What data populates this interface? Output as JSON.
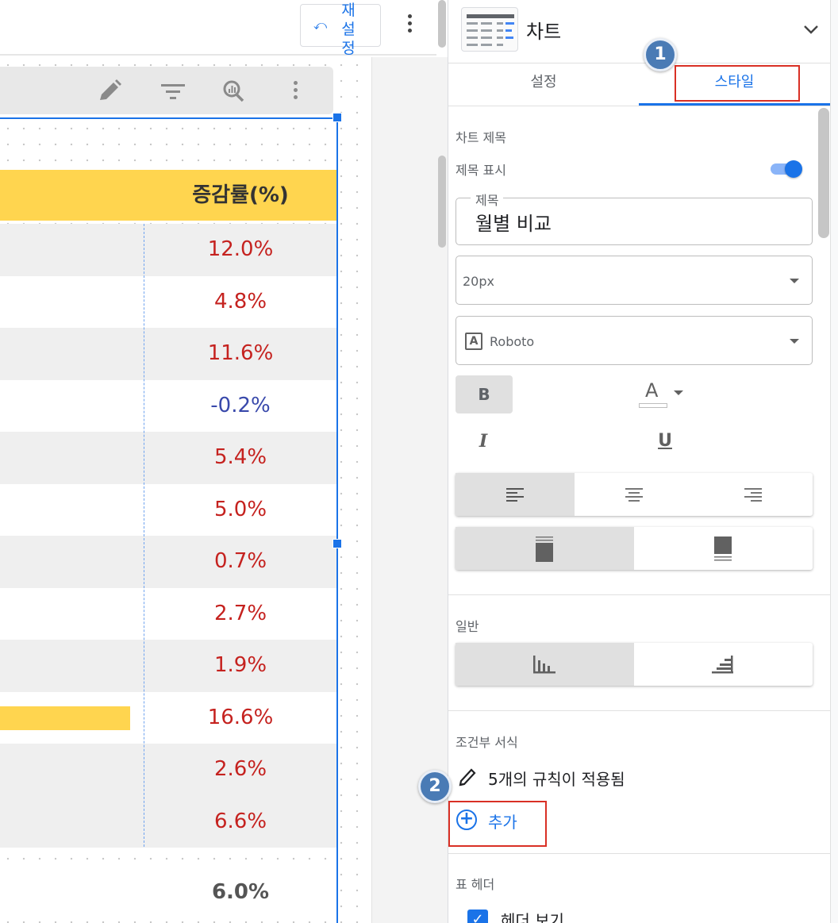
{
  "toolbar": {
    "reset_label": "재설정"
  },
  "table": {
    "header": "증감률(%)",
    "rows": [
      {
        "value": "12.0%",
        "color": "#c5221f",
        "shaded": true
      },
      {
        "value": "4.8%",
        "color": "#c5221f",
        "shaded": false
      },
      {
        "value": "11.6%",
        "color": "#c5221f",
        "shaded": true
      },
      {
        "value": "-0.2%",
        "color": "#3949ab",
        "shaded": false
      },
      {
        "value": "5.4%",
        "color": "#c5221f",
        "shaded": true
      },
      {
        "value": "5.0%",
        "color": "#c5221f",
        "shaded": false
      },
      {
        "value": "0.7%",
        "color": "#c5221f",
        "shaded": true
      },
      {
        "value": "2.7%",
        "color": "#c5221f",
        "shaded": false
      },
      {
        "value": "1.9%",
        "color": "#c5221f",
        "shaded": true
      },
      {
        "value": "16.6%",
        "color": "#c5221f",
        "shaded": false
      },
      {
        "value": "2.6%",
        "color": "#c5221f",
        "shaded": true
      },
      {
        "value": "6.6%",
        "color": "#c5221f",
        "shaded": true
      }
    ],
    "total": "6.0%"
  },
  "panel": {
    "title": "차트",
    "tabs": [
      "설정",
      "스타일"
    ],
    "active_tab": "스타일",
    "chart_title_section": "차트 제목",
    "show_title_label": "제목 표시",
    "show_title_on": true,
    "title_field_label": "제목",
    "title_value": "월별 비교",
    "font_size": "20px",
    "font_family": "Roboto",
    "bold_label": "B",
    "italic_label": "I",
    "underline_label": "U",
    "color_label": "A",
    "general_section": "일반",
    "conditional_section": "조건부 서식",
    "rules_applied": "5개의 규칙이 적용됨",
    "add_label": "추가",
    "header_section": "표 헤더",
    "show_header_label": "헤더 보기",
    "show_header_checked": true
  },
  "annotations": {
    "step1": "1",
    "step2": "2"
  },
  "colors": {
    "accent": "#1a73e8",
    "header_bg": "#ffd54f",
    "positive": "#c5221f",
    "negative": "#3949ab",
    "highlight_box": "#d93025"
  }
}
